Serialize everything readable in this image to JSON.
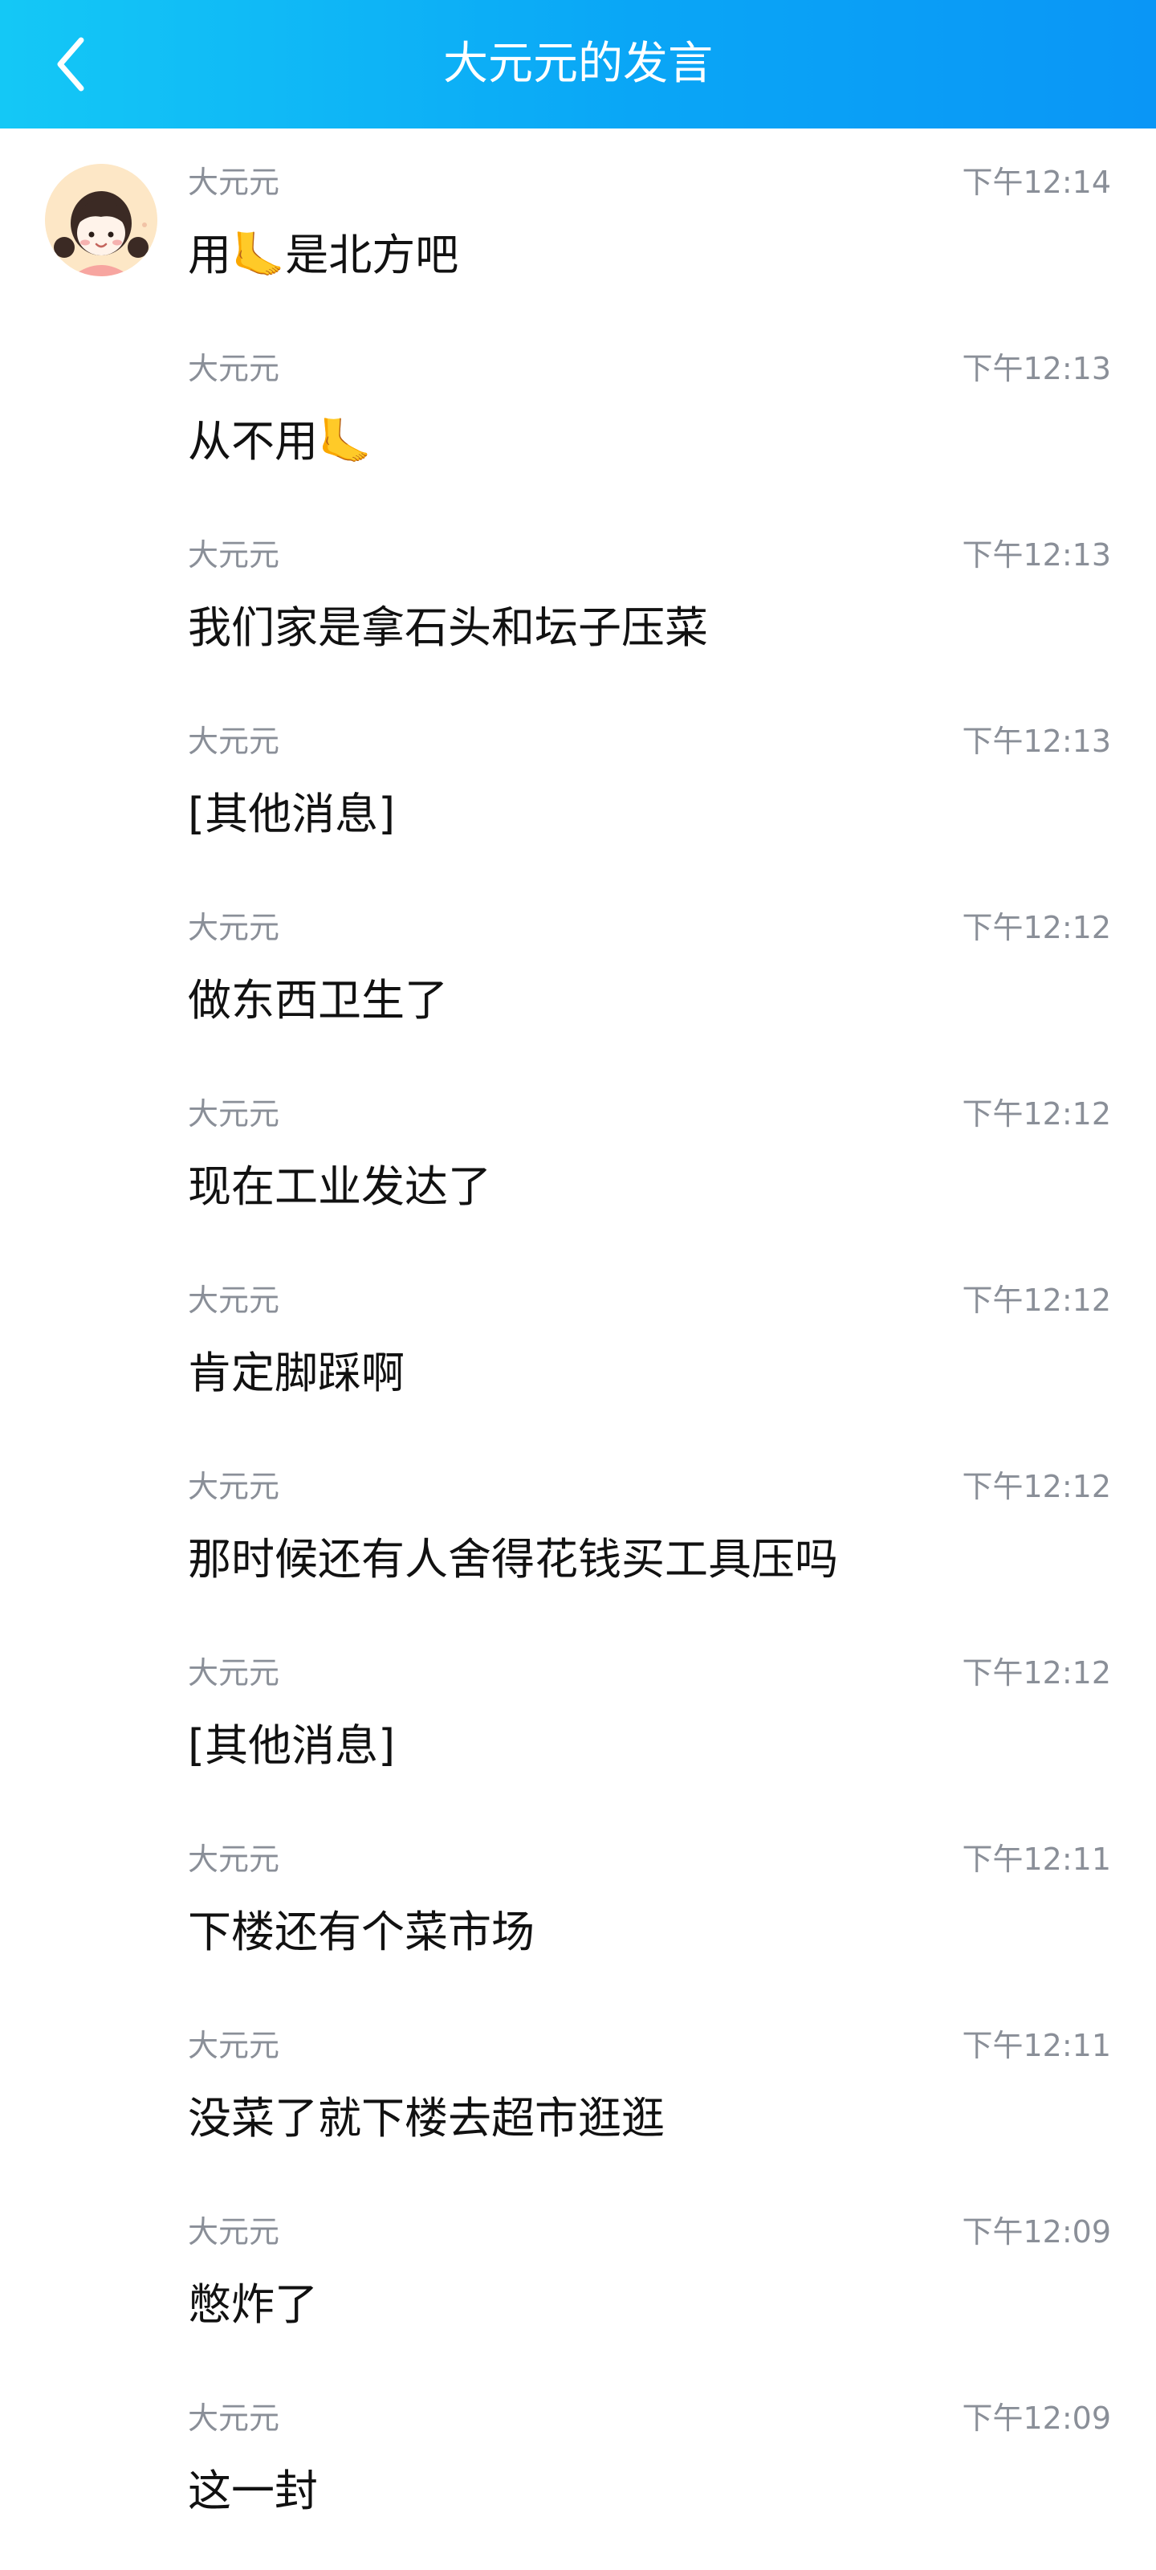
{
  "header": {
    "title": "大元元的发言",
    "back_icon": "chevron-left-icon",
    "gradient": [
      "#14c8f6",
      "#0a96f6"
    ]
  },
  "messages": [
    {
      "name": "大元元",
      "time": "下午12:14",
      "text": "用🦶是北方吧"
    },
    {
      "name": "大元元",
      "time": "下午12:13",
      "text": "从不用🦶"
    },
    {
      "name": "大元元",
      "time": "下午12:13",
      "text": "我们家是拿石头和坛子压菜"
    },
    {
      "name": "大元元",
      "time": "下午12:13",
      "text": "[其他消息]"
    },
    {
      "name": "大元元",
      "time": "下午12:12",
      "text": "做东西卫生了"
    },
    {
      "name": "大元元",
      "time": "下午12:12",
      "text": "现在工业发达了"
    },
    {
      "name": "大元元",
      "time": "下午12:12",
      "text": "肯定脚踩啊"
    },
    {
      "name": "大元元",
      "time": "下午12:12",
      "text": "那时候还有人舍得花钱买工具压吗"
    },
    {
      "name": "大元元",
      "time": "下午12:12",
      "text": "[其他消息]"
    },
    {
      "name": "大元元",
      "time": "下午12:11",
      "text": "下楼还有个菜市场"
    },
    {
      "name": "大元元",
      "time": "下午12:11",
      "text": "没菜了就下楼去超市逛逛"
    },
    {
      "name": "大元元",
      "time": "下午12:09",
      "text": "憋炸了"
    },
    {
      "name": "大元元",
      "time": "下午12:09",
      "text": "这一封"
    }
  ]
}
